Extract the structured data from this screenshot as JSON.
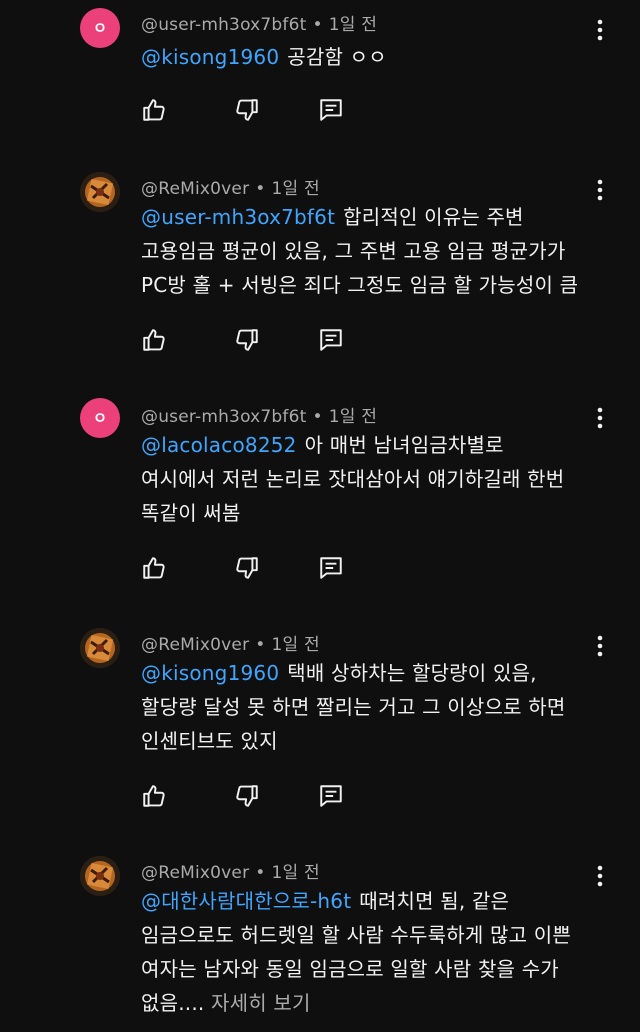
{
  "comments": [
    {
      "author": "@user-mh3ox7bf6t",
      "time": "1일 전",
      "avatar_letter": "ㅇ",
      "avatar_type": "letter",
      "mention": "@kisong1960",
      "lines": [
        "공감함 ㅇㅇ"
      ]
    },
    {
      "author": "@ReMix0ver",
      "time": "1일 전",
      "avatar_type": "image",
      "mention": "@user-mh3ox7bf6t",
      "lines": [
        "합리적인 이유는 주변",
        "고용임금 평균이 있음, 그 주변 고용 임금 평균가가",
        "PC방 홀 + 서빙은 죄다 그정도 임금 할 가능성이 큼"
      ]
    },
    {
      "author": "@user-mh3ox7bf6t",
      "time": "1일 전",
      "avatar_letter": "ㅇ",
      "avatar_type": "letter",
      "mention": "@lacolaco8252",
      "lines": [
        "아 매번 남녀임금차별로",
        "여시에서 저런 논리로 잣대삼아서 얘기하길래 한번",
        "똑같이 써봄"
      ]
    },
    {
      "author": "@ReMix0ver",
      "time": "1일 전",
      "avatar_type": "image",
      "mention": "@kisong1960",
      "lines": [
        "택배 상하차는 할당량이 있음,",
        "할당량 달성 못 하면 짤리는 거고 그 이상으로 하면",
        "인센티브도 있지"
      ]
    },
    {
      "author": "@ReMix0ver",
      "time": "1일 전",
      "avatar_type": "image",
      "mention": "@대한사람대한으로-h6t",
      "lines": [
        "때려치면 됨, 같은",
        "임금으로도 허드렛일 할 사람 수두룩하게 많고 이쁜",
        "여자는 남자와 동일 임금으로 일할 사람 찾을 수가",
        "없음...."
      ],
      "more_label": "자세히 보기"
    }
  ],
  "separator": "•",
  "icons": {
    "like": "thumb-up-icon",
    "dislike": "thumb-down-icon",
    "reply": "reply-icon",
    "menu": "more-vert-icon"
  },
  "colors": {
    "background": "#0f0f0f",
    "text": "#f1f1f1",
    "meta": "#aaaaaa",
    "mention": "#3ea6ff",
    "avatar_pink": "#ec407a"
  }
}
